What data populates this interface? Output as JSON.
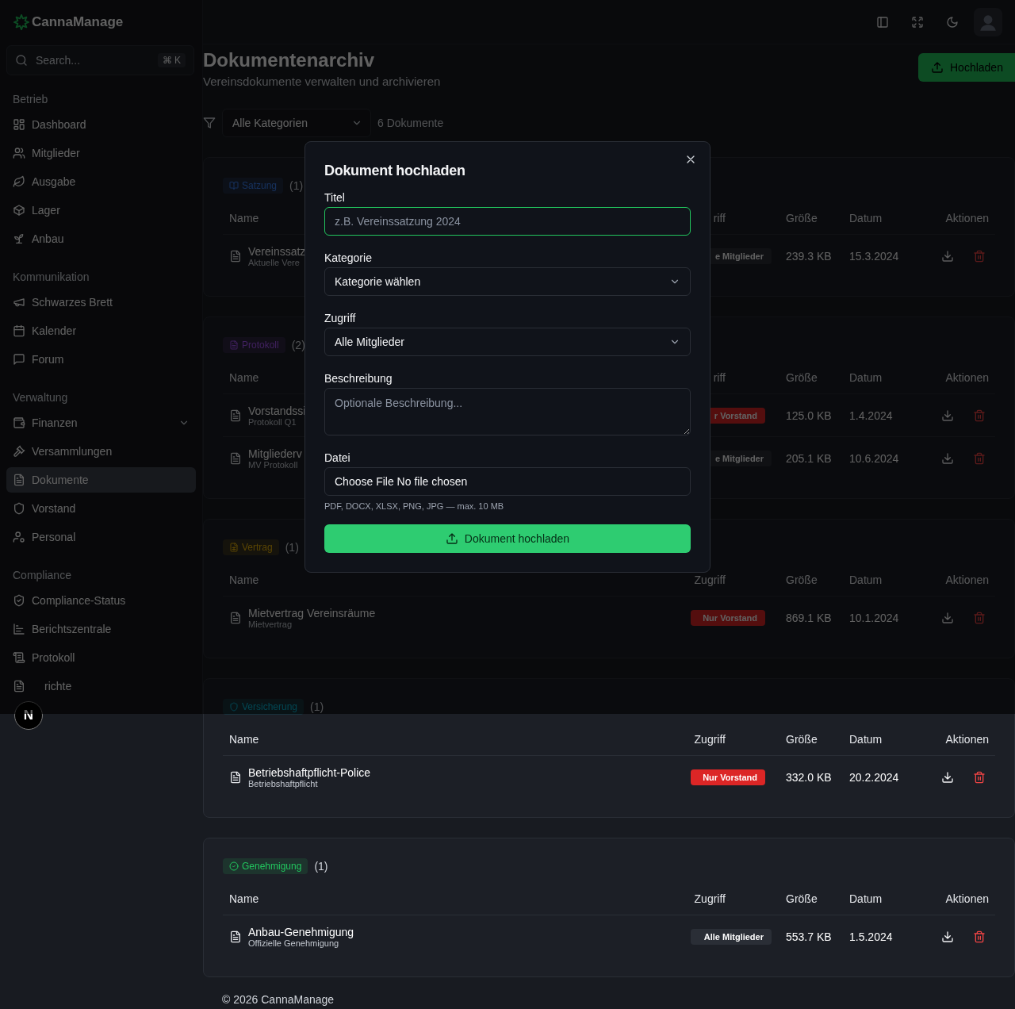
{
  "sidebar": {
    "logo": "CannaManage",
    "search": {
      "placeholder": "Search...",
      "shortcut": "⌘ K"
    },
    "sections": [
      {
        "title": "Betrieb",
        "items": [
          {
            "label": "Dashboard",
            "selected": false,
            "submenu": false
          },
          {
            "label": "Mitglieder",
            "selected": false,
            "submenu": false
          },
          {
            "label": "Ausgabe",
            "selected": false,
            "submenu": false
          },
          {
            "label": "Lager",
            "selected": false,
            "submenu": false
          },
          {
            "label": "Anbau",
            "selected": false,
            "submenu": false
          }
        ]
      },
      {
        "title": "Kommunikation",
        "items": [
          {
            "label": "Schwarzes Brett",
            "selected": false,
            "submenu": false
          },
          {
            "label": "Kalender",
            "selected": false,
            "submenu": false
          },
          {
            "label": "Forum",
            "selected": false,
            "submenu": false
          }
        ]
      },
      {
        "title": "Verwaltung",
        "items": [
          {
            "label": "Finanzen",
            "selected": false,
            "submenu": true
          },
          {
            "label": "Versammlungen",
            "selected": false,
            "submenu": false
          },
          {
            "label": "Dokumente",
            "selected": true,
            "submenu": false
          },
          {
            "label": "Vorstand",
            "selected": false,
            "submenu": false
          },
          {
            "label": "Personal",
            "selected": false,
            "submenu": false
          }
        ]
      },
      {
        "title": "Compliance",
        "items": [
          {
            "label": "Compliance-Status",
            "selected": false,
            "submenu": false
          },
          {
            "label": "Berichtszentrale",
            "selected": false,
            "submenu": false
          },
          {
            "label": "Protokoll",
            "selected": false,
            "submenu": false
          },
          {
            "label": "richte",
            "selected": false,
            "submenu": false
          }
        ]
      }
    ],
    "dev_badge": "N"
  },
  "page": {
    "title": "Dokumentenarchiv",
    "subtitle": "Vereinsdokumente verwalten und archivieren",
    "upload_button": "Hochladen",
    "filter": {
      "value": "Alle Kategorien",
      "count": "6 Dokumente"
    }
  },
  "categories": [
    {
      "kind": "statute",
      "label": "Satzung",
      "count": "(1)",
      "columns": [
        "Name",
        "riff",
        "Größe",
        "Datum",
        "Aktionen"
      ],
      "rows": [
        {
          "name": "Vereinssatz",
          "description": "Aktuelle Vere",
          "access": "e Mitglieder",
          "restricted": false,
          "size": "239.3 KB",
          "date": "15.3.2024"
        }
      ]
    },
    {
      "kind": "minutes",
      "label": "Protokoll",
      "count": "(2)",
      "columns": [
        "Name",
        "riff",
        "Größe",
        "Datum",
        "Aktionen"
      ],
      "rows": [
        {
          "name": "Vorstandssi",
          "description": "Protokoll Q1",
          "access": "r Vorstand",
          "restricted": true,
          "size": "125.0 KB",
          "date": "1.4.2024"
        },
        {
          "name": "Mitgliederv",
          "description": "MV Protokoll",
          "access": "e Mitglieder",
          "restricted": false,
          "size": "205.1 KB",
          "date": "10.6.2024"
        }
      ]
    },
    {
      "kind": "contract",
      "label": "Vertrag",
      "count": "(1)",
      "columns": [
        "Name",
        "Zugriff",
        "Größe",
        "Datum",
        "Aktionen"
      ],
      "rows": [
        {
          "name": "Mietvertrag Vereinsräume",
          "description": "Mietvertrag",
          "access": "Nur Vorstand",
          "restricted": true,
          "size": "869.1 KB",
          "date": "10.1.2024"
        }
      ]
    },
    {
      "kind": "insurance",
      "label": "Versicherung",
      "count": "(1)",
      "columns": [
        "Name",
        "Zugriff",
        "Größe",
        "Datum",
        "Aktionen"
      ],
      "rows": [
        {
          "name": "Betriebshaftpflicht-Police",
          "description": "Betriebshaftpflicht",
          "access": "Nur Vorstand",
          "restricted": true,
          "size": "332.0 KB",
          "date": "20.2.2024"
        }
      ]
    },
    {
      "kind": "permit",
      "label": "Genehmigung",
      "count": "(1)",
      "columns": [
        "Name",
        "Zugriff",
        "Größe",
        "Datum",
        "Aktionen"
      ],
      "rows": [
        {
          "name": "Anbau-Genehmigung",
          "description": "Offizielle Genehmigung",
          "access": "Alle Mitglieder",
          "restricted": false,
          "size": "553.7 KB",
          "date": "1.5.2024"
        }
      ]
    }
  ],
  "footer": "© 2026 CannaManage",
  "dialog": {
    "title": "Dokument hochladen",
    "fields": [
      {
        "kind": "text",
        "label": "Titel",
        "placeholder": "z.B. Vereinssatzung 2024",
        "focused": true
      },
      {
        "kind": "select",
        "label": "Kategorie",
        "value": "Kategorie wählen",
        "focused": false
      },
      {
        "kind": "select",
        "label": "Zugriff",
        "value": "Alle Mitglieder",
        "focused": false
      },
      {
        "kind": "textarea",
        "label": "Beschreibung",
        "placeholder": "Optionale Beschreibung...",
        "focused": false
      },
      {
        "kind": "file",
        "label": "Datei",
        "button": "Choose File",
        "value": "No file chosen",
        "hint": "PDF, DOCX, XLSX, PNG, JPG — max. 10 MB",
        "focused": false
      }
    ],
    "submit": "Dokument hochladen"
  }
}
